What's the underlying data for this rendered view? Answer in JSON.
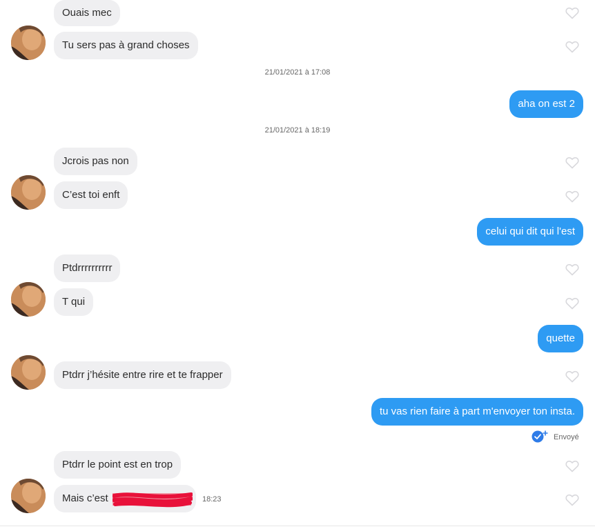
{
  "messages": {
    "m1": "Ouais mec",
    "m2": "Tu sers pas à grand choses",
    "m3": "aha on est 2",
    "m4": "Jcrois pas non",
    "m5": "C’est toi enft",
    "m6": "celui qui dit qui l'est",
    "m7": "Ptdrrrrrrrrrr",
    "m8": "T qui",
    "m9": "quette",
    "m10": "Ptdrr j’hésite entre rire et te frapper",
    "m11": "tu vas rien faire à part m'envoyer ton insta.",
    "m12": "Ptdrr le point est en trop",
    "m13": "Mais c’est "
  },
  "timestamps": {
    "t1": "21/01/2021 à 17:08",
    "t2": "21/01/2021 à 18:19"
  },
  "last_message_time": "18:23",
  "sent_status": "Envoyé",
  "colors": {
    "outgoing_bubble": "#2e9bf3",
    "incoming_bubble": "#efeff1",
    "heart_outline": "#d8d8dc",
    "read_check": "#2e7ce8",
    "redaction": "#e8113a"
  }
}
